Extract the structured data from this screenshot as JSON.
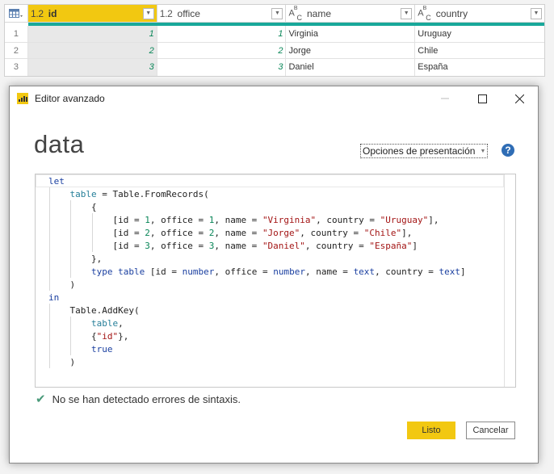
{
  "grid": {
    "columns": [
      {
        "type": "1.2",
        "name": "id",
        "selected": true
      },
      {
        "type": "1.2",
        "name": "office",
        "selected": false
      },
      {
        "type": "ABC",
        "name": "name",
        "selected": false
      },
      {
        "type": "ABC",
        "name": "country",
        "selected": false
      }
    ],
    "rows": [
      {
        "n": "1",
        "id": "1",
        "office": "1",
        "name": "Virginia",
        "country": "Uruguay"
      },
      {
        "n": "2",
        "id": "2",
        "office": "2",
        "name": "Jorge",
        "country": "Chile"
      },
      {
        "n": "3",
        "id": "3",
        "office": "3",
        "name": "Daniel",
        "country": "España"
      }
    ],
    "accent": "#f2c811",
    "quality_bar_color": "#18a89a"
  },
  "dialog": {
    "title": "Editor avanzado",
    "query_name": "data",
    "display_options_label": "Opciones de presentación",
    "help_label": "?",
    "status_text": "No se han detectado errores de sintaxis.",
    "ok_label": "Listo",
    "cancel_label": "Cancelar",
    "code_lines": [
      "let",
      "    table = Table.FromRecords(",
      "        {",
      "            [id = 1, office = 1, name = \"Virginia\", country = \"Uruguay\"],",
      "            [id = 2, office = 2, name = \"Jorge\", country = \"Chile\"],",
      "            [id = 3, office = 3, name = \"Daniel\", country = \"España\"]",
      "        },",
      "        type table [id = number, office = number, name = text, country = text]",
      "    )",
      "in",
      "    Table.AddKey(",
      "        table,",
      "        {\"id\"},",
      "        true",
      "    )"
    ]
  }
}
